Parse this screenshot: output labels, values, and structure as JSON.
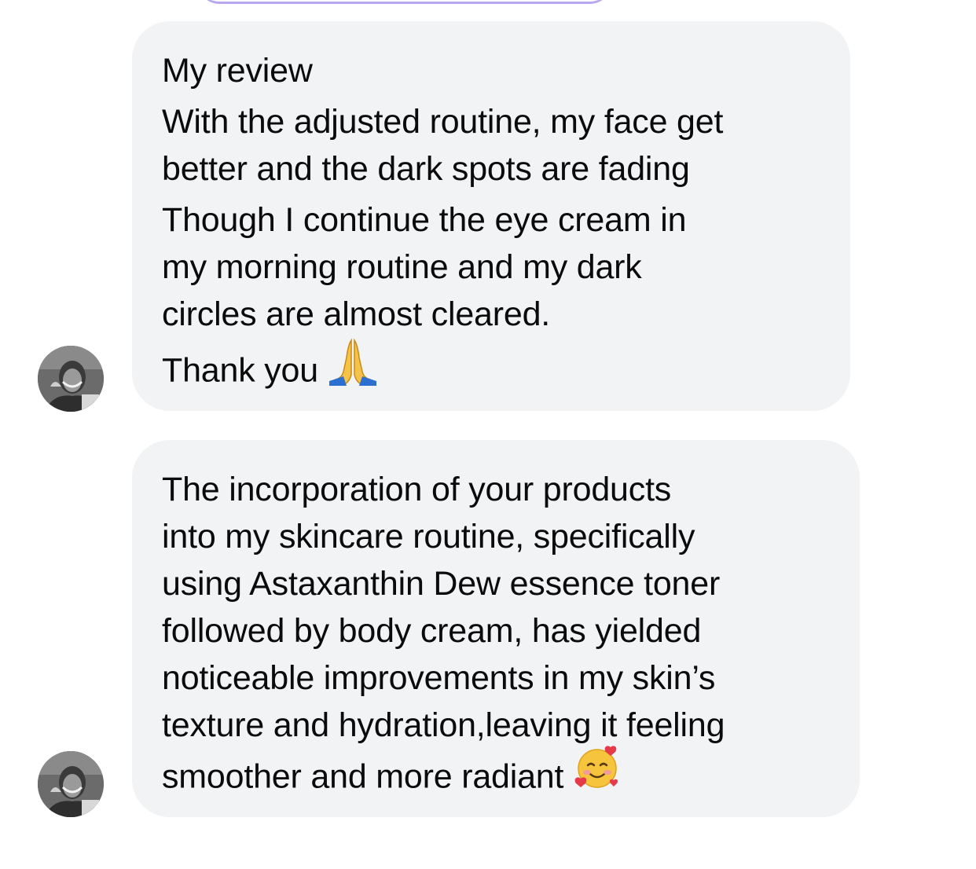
{
  "messages": [
    {
      "lines": [
        "My review",
        "With the adjusted routine, my face get",
        "better and the dark spots are fading",
        "Though I continue the eye cream in",
        "my morning routine and my dark",
        "circles are almost cleared.",
        "Thank you"
      ],
      "emoji": "folded-hands-icon"
    },
    {
      "lines": [
        "The incorporation of your products",
        "into my skincare routine, specifically",
        "using Astaxanthin Dew essence toner",
        "followed by body cream, has yielded",
        "noticeable improvements in my skin’s",
        "texture and hydration,leaving it feeling",
        "smoother and more radiant"
      ],
      "emoji": "smiling-face-with-hearts-icon"
    }
  ],
  "colors": {
    "bubble_bg": "#f2f3f5",
    "text": "#0b0b0b",
    "prev_bubble_border": "#b9a6f3"
  }
}
